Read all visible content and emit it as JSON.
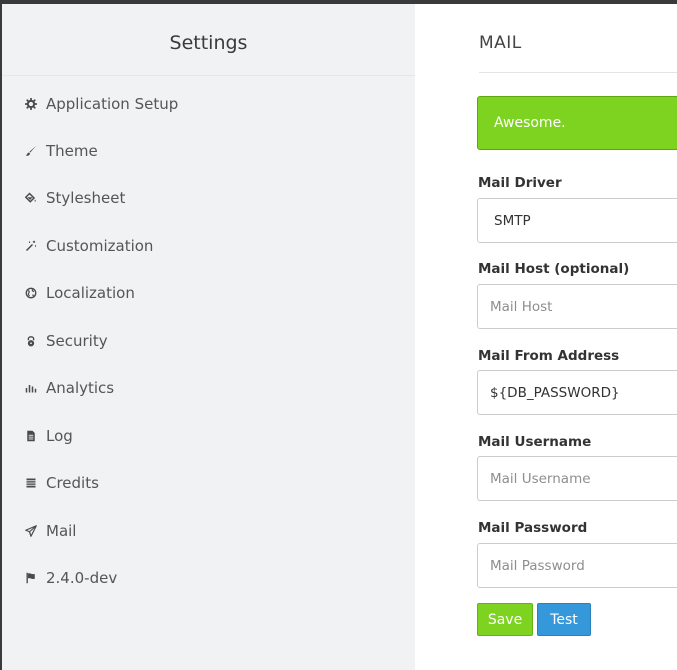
{
  "sidebar": {
    "title": "Settings",
    "items": [
      {
        "label": "Application Setup",
        "icon": "gear-icon"
      },
      {
        "label": "Theme",
        "icon": "brush-icon"
      },
      {
        "label": "Stylesheet",
        "icon": "paint-bucket-icon"
      },
      {
        "label": "Customization",
        "icon": "magic-wand-icon"
      },
      {
        "label": "Localization",
        "icon": "globe-icon"
      },
      {
        "label": "Security",
        "icon": "lock-icon"
      },
      {
        "label": "Analytics",
        "icon": "bar-chart-icon"
      },
      {
        "label": "Log",
        "icon": "file-icon"
      },
      {
        "label": "Credits",
        "icon": "list-icon"
      },
      {
        "label": "Mail",
        "icon": "paper-plane-icon"
      },
      {
        "label": "2.4.0-dev",
        "icon": "flag-icon"
      }
    ]
  },
  "main": {
    "title": "MAIL",
    "alert": "Awesome.",
    "fields": {
      "driver": {
        "label": "Mail Driver",
        "value": "SMTP"
      },
      "host": {
        "label": "Mail Host (optional)",
        "value": "",
        "placeholder": "Mail Host"
      },
      "from": {
        "label": "Mail From Address",
        "value": "${DB_PASSWORD}",
        "placeholder": "Mail From Address"
      },
      "username": {
        "label": "Mail Username",
        "value": "",
        "placeholder": "Mail Username"
      },
      "password": {
        "label": "Mail Password",
        "value": "",
        "placeholder": "Mail Password"
      }
    },
    "buttons": {
      "save": "Save",
      "test": "Test"
    }
  },
  "colors": {
    "success": "#7ed321",
    "primary": "#3498db",
    "sidebar_bg": "#f1f2f3"
  }
}
